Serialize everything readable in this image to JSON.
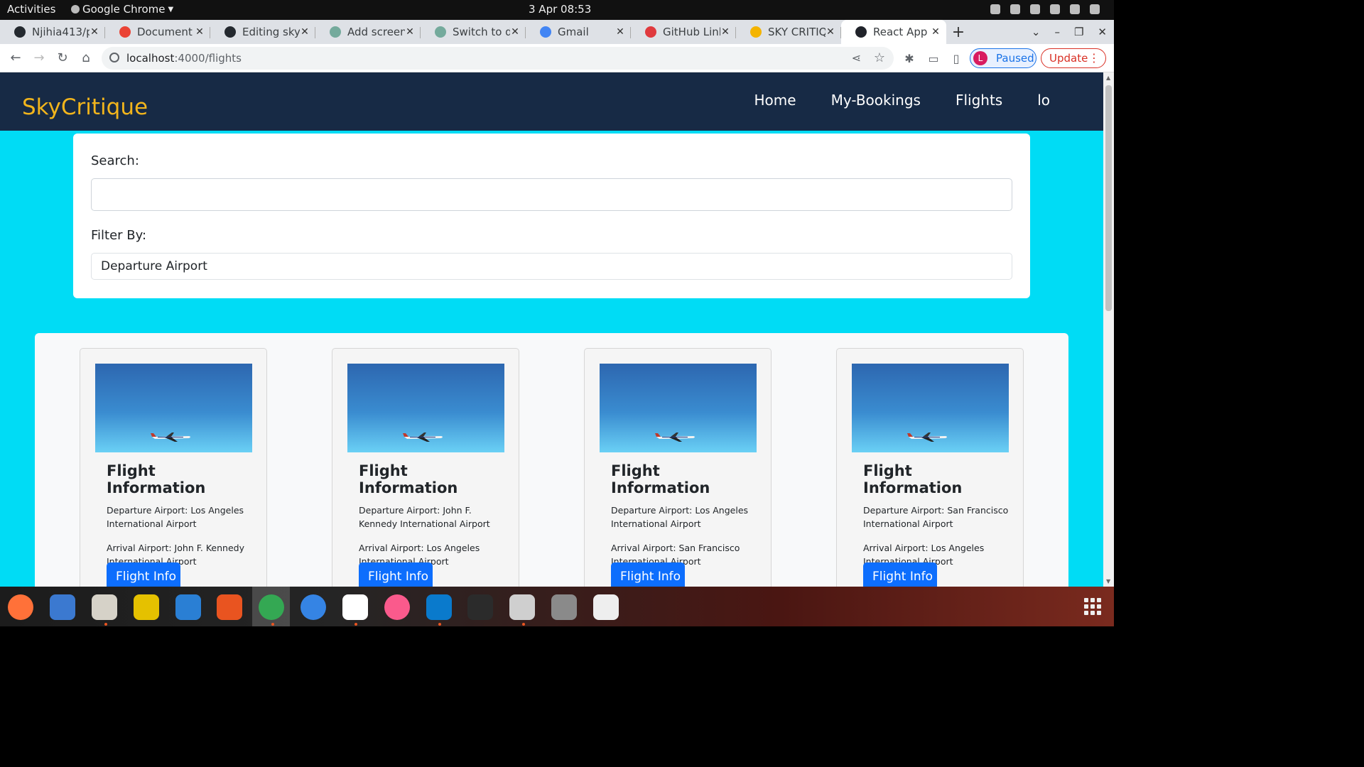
{
  "system": {
    "activities": "Activities",
    "app_menu": "Google Chrome",
    "clock": "3 Apr  08:53"
  },
  "browser": {
    "tabs": [
      {
        "label": "Njihia413/p",
        "favicon_color": "#24292f"
      },
      {
        "label": "Document s",
        "favicon_color": "#ea4335"
      },
      {
        "label": "Editing sky-",
        "favicon_color": "#24292f"
      },
      {
        "label": "Add screens",
        "favicon_color": "#74aa9c"
      },
      {
        "label": "Switch to de",
        "favicon_color": "#74aa9c"
      },
      {
        "label": "Gmail",
        "favicon_color": "#4285f4"
      },
      {
        "label": "GitHub Link",
        "favicon_color": "#e03a3e"
      },
      {
        "label": "SKY CRITIQ",
        "favicon_color": "#f4b400"
      },
      {
        "label": "React App",
        "favicon_color": "#20232a"
      }
    ],
    "active_tab_index": 8,
    "url_host": "localhost",
    "url_path": ":4000/flights",
    "profile_initial": "L",
    "profile_status": "Paused",
    "update_label": "Update"
  },
  "app": {
    "brand": "SkyCritique",
    "nav": [
      "Home",
      "My-Bookings",
      "Flights",
      "lo"
    ],
    "search_label": "Search:",
    "search_value": "",
    "filter_label": "Filter By:",
    "filter_value": "Departure Airport",
    "flights": [
      {
        "title": "Flight Information",
        "departure": "Departure Airport: Los Angeles International Airport",
        "arrival": "Arrival Airport: John F. Kennedy International Airport",
        "button": "Flight Info"
      },
      {
        "title": "Flight Information",
        "departure": "Departure Airport: John F. Kennedy International Airport",
        "arrival": "Arrival Airport: Los Angeles International Airport",
        "button": "Flight Info"
      },
      {
        "title": "Flight Information",
        "departure": "Departure Airport: Los Angeles International Airport",
        "arrival": "Arrival Airport: San Francisco International Airport",
        "button": "Flight Info"
      },
      {
        "title": "Flight Information",
        "departure": "Departure Airport: San Francisco International Airport",
        "arrival": "Arrival Airport: Los Angeles International Airport",
        "button": "Flight Info"
      }
    ]
  },
  "dock": {
    "apps": [
      {
        "name": "firefox-icon",
        "color": "#ff7139"
      },
      {
        "name": "thunderbird-icon",
        "color": "#3b79d0"
      },
      {
        "name": "files-icon",
        "color": "#d6d2c8"
      },
      {
        "name": "rhythmbox-icon",
        "color": "#e5c100"
      },
      {
        "name": "writer-icon",
        "color": "#2a7fd4"
      },
      {
        "name": "software-icon",
        "color": "#e95420"
      },
      {
        "name": "chrome-icon",
        "color": "#34a853"
      },
      {
        "name": "help-icon",
        "color": "#3584e4"
      },
      {
        "name": "slack-icon",
        "color": "#ffffff"
      },
      {
        "name": "music-icon",
        "color": "#fa5a8c"
      },
      {
        "name": "vscode-icon",
        "color": "#0a7acc"
      },
      {
        "name": "terminal-icon",
        "color": "#2b2b2b"
      },
      {
        "name": "settings-icon",
        "color": "#cfcfcf"
      },
      {
        "name": "device-icon",
        "color": "#8a8a8a"
      },
      {
        "name": "screenshot-icon",
        "color": "#eeeeee"
      }
    ]
  }
}
